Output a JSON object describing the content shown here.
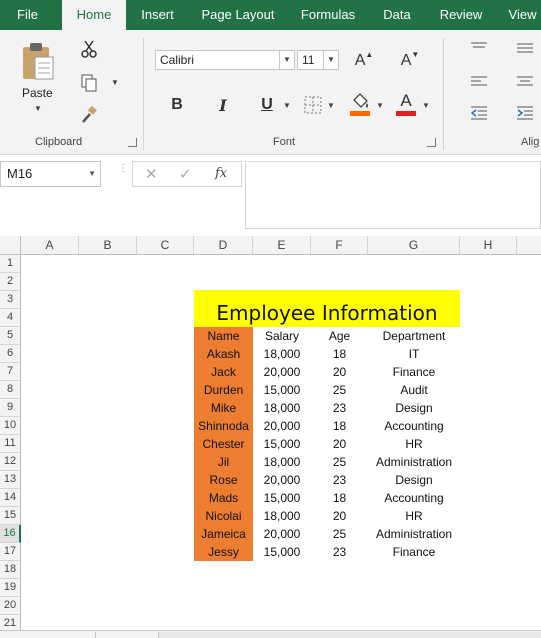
{
  "tabs": [
    "File",
    "Home",
    "Insert",
    "Page Layout",
    "Formulas",
    "Data",
    "Review",
    "View"
  ],
  "active_tab": "Home",
  "ribbon": {
    "clipboard_label": "Clipboard",
    "paste_label": "Paste",
    "font_label": "Font",
    "alignment_label": "Alig",
    "font_name": "Calibri",
    "font_size": "11",
    "bold": "B",
    "italic": "I",
    "underline": "U",
    "font_color_letter": "A",
    "grow_font": "A",
    "shrink_font": "A",
    "highlight_color": "#ff6600",
    "font_color": "#e02020"
  },
  "formula_bar": {
    "name_box": "M16",
    "cancel": "✕",
    "enter": "✓",
    "fx": "fx",
    "value": ""
  },
  "columns": [
    "A",
    "B",
    "C",
    "D",
    "E",
    "F",
    "G",
    "H"
  ],
  "rows": [
    "1",
    "2",
    "3",
    "4",
    "5",
    "6",
    "7",
    "8",
    "9",
    "10",
    "11",
    "12",
    "13",
    "14",
    "15",
    "16",
    "17",
    "18",
    "19",
    "20",
    "21"
  ],
  "selected_row": "16",
  "sheet": {
    "title": "Employee Information",
    "headers": [
      "Name",
      "Salary",
      "Age",
      "Department"
    ],
    "records": [
      [
        "Akash",
        "18,000",
        "18",
        "IT"
      ],
      [
        "Jack",
        "20,000",
        "20",
        "Finance"
      ],
      [
        "Durden",
        "15,000",
        "25",
        "Audit"
      ],
      [
        "Mike",
        "18,000",
        "23",
        "Design"
      ],
      [
        "Shinnoda",
        "20,000",
        "18",
        "Accounting"
      ],
      [
        "Chester",
        "15,000",
        "20",
        "HR"
      ],
      [
        "Jil",
        "18,000",
        "25",
        "Administration"
      ],
      [
        "Rose",
        "20,000",
        "23",
        "Design"
      ],
      [
        "Mads",
        "15,000",
        "18",
        "Accounting"
      ],
      [
        "Nicolai",
        "18,000",
        "20",
        "HR"
      ],
      [
        "Jameica",
        "20,000",
        "25",
        "Administration"
      ],
      [
        "Jessy",
        "15,000",
        "23",
        "Finance"
      ]
    ],
    "title_fill": "#ffff00",
    "name_fill": "#ed7d31"
  },
  "colors": {
    "excel_green": "#217346"
  }
}
